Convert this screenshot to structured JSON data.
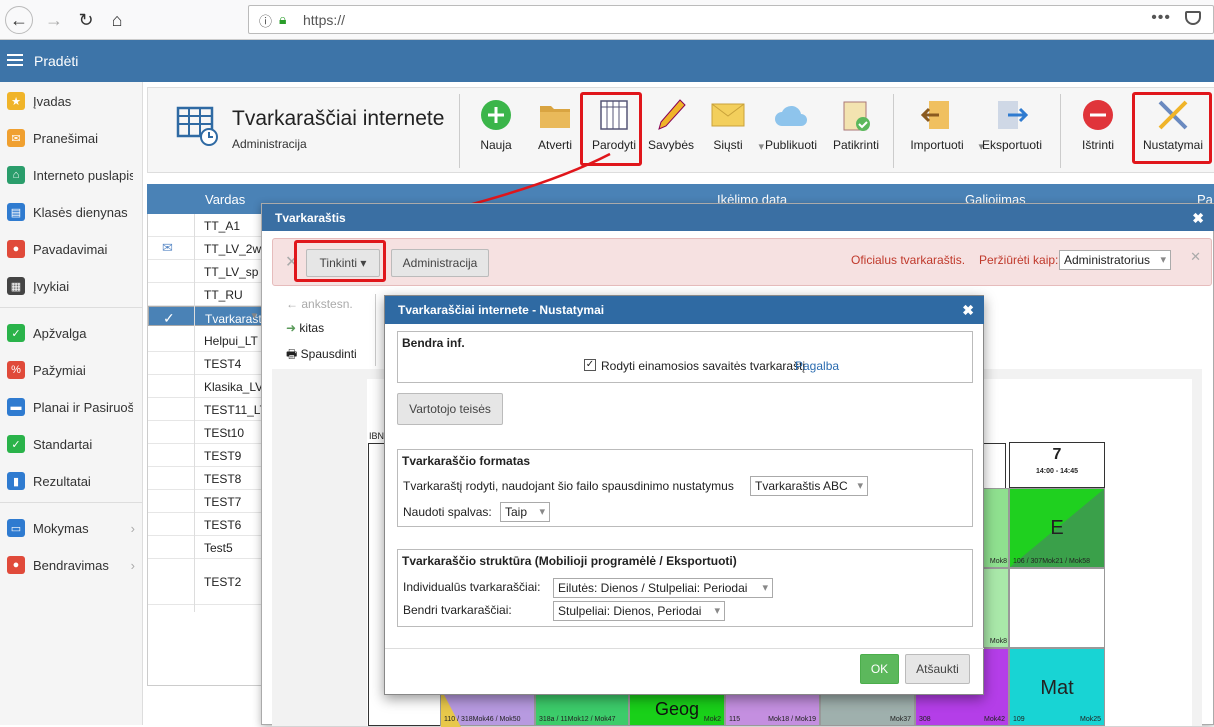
{
  "browser": {
    "url": "https://"
  },
  "appbar": {
    "title": "Pradėti"
  },
  "sidebar": {
    "items": [
      {
        "label": "Įvadas",
        "icon": "star-icon",
        "color": "#f0b429"
      },
      {
        "label": "Pranešimai",
        "icon": "mail-icon",
        "color": "#f0a030"
      },
      {
        "label": "Interneto puslapis",
        "icon": "home-icon",
        "color": "#2a9d6b"
      },
      {
        "label": "Klasės dienynas",
        "icon": "book-icon",
        "color": "#2f7bd0"
      },
      {
        "label": "Pavadavimai",
        "icon": "person-icon",
        "color": "#e04a3a"
      },
      {
        "label": "Įvykiai",
        "icon": "calendar-icon",
        "color": "#444444"
      },
      {
        "label": "Apžvalga",
        "icon": "check-circle-icon",
        "color": "#2ab34a"
      },
      {
        "label": "Pažymiai",
        "icon": "grade-icon",
        "color": "#e04a3a"
      },
      {
        "label": "Planai ir Pasiruošimai",
        "icon": "briefcase-icon",
        "color": "#2f7bd0"
      },
      {
        "label": "Standartai",
        "icon": "shield-icon",
        "color": "#2ab34a"
      },
      {
        "label": "Rezultatai",
        "icon": "bar-chart-icon",
        "color": "#2f7bd0"
      },
      {
        "label": "Mokymas",
        "icon": "book-open-icon",
        "color": "#2f7bd0"
      },
      {
        "label": "Bendravimas",
        "icon": "chat-icon",
        "color": "#e04a3a"
      }
    ]
  },
  "toolbar": {
    "title": "Tvarkaraščiai internete",
    "subtitle": "Administracija",
    "buttons": [
      "Nauja",
      "Atverti",
      "Parodyti",
      "Savybės",
      "Siųsti",
      "Publikuoti",
      "Patikrinti",
      "Importuoti",
      "Eksportuoti",
      "Ištrinti",
      "Nustatymai"
    ]
  },
  "list": {
    "headers": [
      "Vardas",
      "Įkėlimo data",
      "Galiojimas",
      "Pa"
    ],
    "rows": [
      "TT_A1",
      "TT_LV_2w",
      "TT_LV_sp",
      "TT_RU",
      "Tvarkarašt",
      "Helpui_LT",
      "TEST4",
      "Klasika_LV",
      "TEST11_LT",
      "TESt10",
      "TEST9",
      "TEST8",
      "TEST7",
      "TEST6",
      "Test5",
      "TEST2"
    ]
  },
  "dialog1": {
    "title": "Tvarkaraštis",
    "tinkinti": "Tinkinti ▾",
    "administracija": "Administracija",
    "official": "Oficialus tvarkaraštis.",
    "view_as": "Peržiūrėti kaip:",
    "view_as_value": "Administratorius",
    "nav_prev": "ankstesn.",
    "nav_next": "kitas",
    "nav_print": "Spausdinti",
    "grid": {
      "col_num": "7",
      "col_time": "14:00 - 14:45",
      "corner": "IBN",
      "c_e": "E",
      "c_e_foot": "106 / 307Mok21 / Mok58",
      "c_mat": "Mat",
      "c_mat_foot1": "109",
      "c_mat_foot2": "Mok25",
      "c_geog": "Geog",
      "c_geog_foot": "Mok2",
      "f1": "110 / 318Mok46 / Mok50",
      "f2": "318a / 11Mok12 / Mok47",
      "f3": "115",
      "f3b": "Mok18 / Mok19",
      "f4": "Mok37",
      "f5": "308",
      "f5b": "Mok42",
      "m8a": "Mok8",
      "m8b": "Mok8"
    }
  },
  "dialog2": {
    "title": "Tvarkaraščiai internete - Nustatymai",
    "general": "Bendra inf.",
    "show_current": "Rodyti einamosios savaitės tvarkaraštį",
    "help": "Pagalba",
    "user_rights": "Vartotojo teisės",
    "format_title": "Tvarkaraščio formatas",
    "format_label": "Tvarkaraštį rodyti, naudojant šio failo spausdinimo nustatymus",
    "format_value": "Tvarkaraštis ABC",
    "colors_label": "Naudoti spalvas:",
    "colors_value": "Taip",
    "struct_title": "Tvarkaraščio struktūra (Mobilioji programėlė / Eksportuoti)",
    "indiv_label": "Individualūs tvarkaraščiai:",
    "indiv_value": "Eilutės: Dienos / Stulpeliai: Periodai",
    "common_label": "Bendri tvarkaraščiai:",
    "common_value": "Stulpeliai: Dienos, Periodai",
    "ok": "OK",
    "cancel": "Atšaukti"
  }
}
